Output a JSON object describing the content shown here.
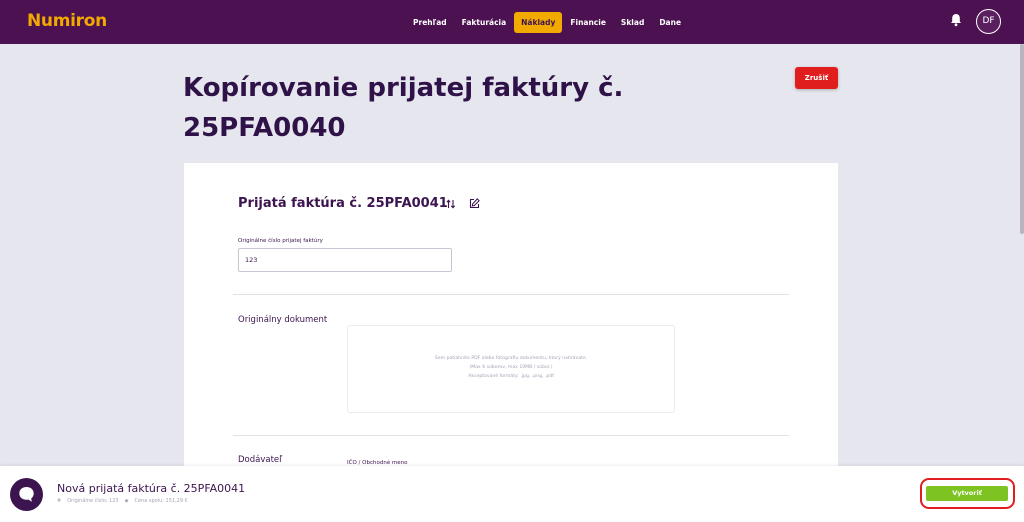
{
  "app": {
    "logo": "Numiron",
    "user_initials": "DF"
  },
  "nav": {
    "items": [
      {
        "label": "Prehľad",
        "active": false
      },
      {
        "label": "Fakturácia",
        "active": false
      },
      {
        "label": "Náklady",
        "active": true
      },
      {
        "label": "Financie",
        "active": false
      },
      {
        "label": "Sklad",
        "active": false
      },
      {
        "label": "Dane",
        "active": false
      }
    ]
  },
  "page": {
    "title": "Kopírovanie prijatej faktúry č. 25PFA0040",
    "cancel_label": "Zrušiť"
  },
  "form": {
    "invoice_heading": "Prijatá faktúra č. 25PFA0041",
    "original_number_label": "Originálne číslo prijatej faktúry",
    "original_number_value": "123",
    "original_document_label": "Originálny dokument",
    "dropzone_lines": [
      "Sem potiahnite PDF alebo fotografiu dokumentu, ktorý nahrávate.",
      "(Max 6 súborov, max 10MB / súbor.)",
      "Akceptované formáty: .jpg, .png, .pdf"
    ],
    "supplier_label": "Dodávateľ",
    "ico_label": "IČO / Obchodné meno"
  },
  "footer": {
    "title": "Nová prijatá faktúra č. 25PFA0041",
    "meta_original": "Originálne číslo: 123",
    "meta_price": "Cena spolu: 151,29 €",
    "create_label": "Vytvoriť"
  },
  "colors": {
    "brand": "#4b1150",
    "accent": "#f2a900",
    "danger": "#e01e1e",
    "success": "#7dc322"
  },
  "icons": [
    "bell-icon",
    "sort-icon",
    "edit-icon",
    "hash-icon",
    "tag-icon",
    "chat-icon"
  ]
}
